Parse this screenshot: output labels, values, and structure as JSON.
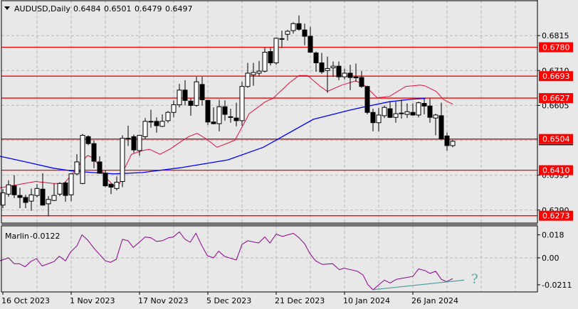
{
  "header": {
    "collapse_icon": "triangle-down-icon",
    "symbol": "AUDUSD,Daily",
    "open": "0.6484",
    "high": "0.6501",
    "low": "0.6479",
    "close": "0.6497"
  },
  "colors": {
    "background": "#e8e8e8",
    "level_line": "#ff0000",
    "ma_fast": "#e0103c",
    "ma_slow": "#0000ff",
    "oscillator": "#8b008b",
    "trendline": "#5aa0a0",
    "candle_up": "#ffffff",
    "candle_down": "#000000"
  },
  "chart_data": [
    {
      "type": "candlestick",
      "title": "AUDUSD,Daily",
      "ylim": [
        0.6251,
        0.692
      ],
      "price_ticks": [
        "0.6815",
        "0.6710",
        "0.6605",
        "0.6395",
        "0.6290"
      ],
      "levels": [
        "0.6780",
        "0.6693",
        "0.6627",
        "0.6504",
        "0.6410",
        "0.6273"
      ],
      "current_price": "0.6504",
      "x_labels": [
        "16 Oct 2023",
        "1 Nov 2023",
        "17 Nov 2023",
        "5 Dec 2023",
        "21 Dec 2023",
        "10 Jan 2024",
        "26 Jan 2024"
      ],
      "x_label_index": [
        0,
        12,
        24,
        36,
        48,
        60,
        72
      ],
      "ohlc": [
        [
          0.6305,
          0.6353,
          0.6296,
          0.6342
        ],
        [
          0.6338,
          0.638,
          0.633,
          0.6366
        ],
        [
          0.6363,
          0.6395,
          0.6326,
          0.6336
        ],
        [
          0.6334,
          0.6357,
          0.6296,
          0.6328
        ],
        [
          0.6328,
          0.6336,
          0.6296,
          0.6313
        ],
        [
          0.6317,
          0.6355,
          0.6288,
          0.6336
        ],
        [
          0.6334,
          0.6368,
          0.6328,
          0.6355
        ],
        [
          0.6353,
          0.6401,
          0.6303,
          0.6305
        ],
        [
          0.6309,
          0.6332,
          0.6271,
          0.6322
        ],
        [
          0.6319,
          0.637,
          0.6317,
          0.6334
        ],
        [
          0.6338,
          0.6374,
          0.6332,
          0.637
        ],
        [
          0.6372,
          0.6376,
          0.6315,
          0.6334
        ],
        [
          0.6336,
          0.6401,
          0.6317,
          0.6399
        ],
        [
          0.6399,
          0.6458,
          0.6395,
          0.6435
        ],
        [
          0.637,
          0.6519,
          0.6368,
          0.6515
        ],
        [
          0.6511,
          0.6515,
          0.6485,
          0.649
        ],
        [
          0.649,
          0.65,
          0.6416,
          0.6437
        ],
        [
          0.6435,
          0.6452,
          0.6399,
          0.6401
        ],
        [
          0.6401,
          0.641,
          0.6359,
          0.6363
        ],
        [
          0.6368,
          0.637,
          0.6338,
          0.6359
        ],
        [
          0.6355,
          0.6391,
          0.6349,
          0.6374
        ],
        [
          0.6376,
          0.6515,
          0.6359,
          0.6506
        ],
        [
          0.6506,
          0.6544,
          0.6483,
          0.6504
        ],
        [
          0.6511,
          0.6517,
          0.6462,
          0.6471
        ],
        [
          0.6469,
          0.6517,
          0.6454,
          0.6515
        ],
        [
          0.6511,
          0.6567,
          0.6504,
          0.6557
        ],
        [
          0.6557,
          0.6592,
          0.6538,
          0.6556
        ],
        [
          0.6557,
          0.6569,
          0.6523,
          0.6544
        ],
        [
          0.6542,
          0.6578,
          0.654,
          0.6557
        ],
        [
          0.6559,
          0.6588,
          0.6553,
          0.6584
        ],
        [
          0.6584,
          0.662,
          0.6569,
          0.6607
        ],
        [
          0.6607,
          0.667,
          0.6599,
          0.6651
        ],
        [
          0.6651,
          0.6681,
          0.6605,
          0.662
        ],
        [
          0.6618,
          0.6626,
          0.6574,
          0.6605
        ],
        [
          0.6605,
          0.6691,
          0.6601,
          0.6676
        ],
        [
          0.6668,
          0.6691,
          0.6605,
          0.6622
        ],
        [
          0.662,
          0.6622,
          0.6546,
          0.6555
        ],
        [
          0.6555,
          0.6599,
          0.6548,
          0.655
        ],
        [
          0.655,
          0.6622,
          0.6527,
          0.6601
        ],
        [
          0.6601,
          0.662,
          0.6559,
          0.6578
        ],
        [
          0.6571,
          0.6595,
          0.6553,
          0.6569
        ],
        [
          0.6567,
          0.6613,
          0.6542,
          0.6559
        ],
        [
          0.6559,
          0.6676,
          0.6544,
          0.6662
        ],
        [
          0.6662,
          0.6733,
          0.6658,
          0.6702
        ],
        [
          0.6697,
          0.6733,
          0.6664,
          0.6704
        ],
        [
          0.6702,
          0.6739,
          0.6693,
          0.6708
        ],
        [
          0.6708,
          0.6779,
          0.6704,
          0.6765
        ],
        [
          0.6767,
          0.6779,
          0.6725,
          0.6733
        ],
        [
          0.6733,
          0.6809,
          0.6727,
          0.6807
        ],
        [
          0.6805,
          0.683,
          0.6777,
          0.6806
        ],
        [
          0.6819,
          0.6832,
          0.68,
          0.6828
        ],
        [
          0.683,
          0.6855,
          0.6821,
          0.6851
        ],
        [
          0.6851,
          0.6876,
          0.683,
          0.6834
        ],
        [
          0.6832,
          0.6851,
          0.6786,
          0.6813
        ],
        [
          0.6813,
          0.6842,
          0.6763,
          0.6765
        ],
        [
          0.6763,
          0.6767,
          0.6706,
          0.6733
        ],
        [
          0.6733,
          0.6763,
          0.67,
          0.6706
        ],
        [
          0.671,
          0.6752,
          0.6643,
          0.6716
        ],
        [
          0.6718,
          0.6737,
          0.6691,
          0.6723
        ],
        [
          0.6723,
          0.6737,
          0.6681,
          0.6691
        ],
        [
          0.6691,
          0.6716,
          0.6683,
          0.6702
        ],
        [
          0.6702,
          0.6727,
          0.6651,
          0.6689
        ],
        [
          0.6689,
          0.6731,
          0.6676,
          0.669
        ],
        [
          0.6689,
          0.6708,
          0.6658,
          0.6662
        ],
        [
          0.6662,
          0.6664,
          0.6578,
          0.6584
        ],
        [
          0.6584,
          0.6595,
          0.6527,
          0.6553
        ],
        [
          0.6553,
          0.6597,
          0.6527,
          0.6576
        ],
        [
          0.6574,
          0.6605,
          0.6567,
          0.6599
        ],
        [
          0.6595,
          0.6616,
          0.6567,
          0.6569
        ],
        [
          0.6569,
          0.6616,
          0.6553,
          0.658
        ],
        [
          0.6582,
          0.6622,
          0.6565,
          0.658
        ],
        [
          0.6578,
          0.6611,
          0.6567,
          0.6586
        ],
        [
          0.6584,
          0.6611,
          0.6574,
          0.6576
        ],
        [
          0.6576,
          0.6616,
          0.6569,
          0.6613
        ],
        [
          0.6611,
          0.6626,
          0.6578,
          0.6603
        ],
        [
          0.6603,
          0.6626,
          0.6553,
          0.6569
        ],
        [
          0.6567,
          0.658,
          0.6515,
          0.6576
        ],
        [
          0.6574,
          0.6613,
          0.6502,
          0.6504
        ],
        [
          0.6513,
          0.6523,
          0.6469,
          0.6484
        ],
        [
          0.6484,
          0.6501,
          0.6479,
          0.6497
        ]
      ],
      "ma_fast": [
        [
          -0.5,
          0.6357
        ],
        [
          5.75,
          0.6376
        ],
        [
          8.9,
          0.637
        ],
        [
          10.75,
          0.637
        ],
        [
          12,
          0.6395
        ],
        [
          13.9,
          0.6437
        ],
        [
          14.9,
          0.6454
        ],
        [
          15.75,
          0.6448
        ],
        [
          17,
          0.6422
        ],
        [
          18.25,
          0.6385
        ],
        [
          19.5,
          0.6363
        ],
        [
          20.5,
          0.637
        ],
        [
          21.4,
          0.6416
        ],
        [
          22.6,
          0.6458
        ],
        [
          24.5,
          0.6469
        ],
        [
          25.75,
          0.6473
        ],
        [
          27.6,
          0.6458
        ],
        [
          29.5,
          0.6475
        ],
        [
          30.75,
          0.649
        ],
        [
          32.6,
          0.6511
        ],
        [
          34.1,
          0.6521
        ],
        [
          35.75,
          0.6504
        ],
        [
          37.6,
          0.6479
        ],
        [
          40.75,
          0.65
        ],
        [
          43.25,
          0.658
        ],
        [
          46.1,
          0.6616
        ],
        [
          47.4,
          0.6626
        ],
        [
          50.4,
          0.6674
        ],
        [
          52,
          0.6695
        ],
        [
          53.5,
          0.6695
        ],
        [
          55.75,
          0.6662
        ],
        [
          57,
          0.6647
        ],
        [
          59.5,
          0.6666
        ],
        [
          62,
          0.6679
        ],
        [
          63.6,
          0.6664
        ],
        [
          65.75,
          0.6628
        ],
        [
          67.9,
          0.6632
        ],
        [
          70.75,
          0.6662
        ],
        [
          73.25,
          0.6666
        ],
        [
          74.1,
          0.6664
        ],
        [
          76.1,
          0.6647
        ],
        [
          77.4,
          0.6622
        ],
        [
          79,
          0.6609
        ]
      ],
      "ma_slow": [
        [
          -0.5,
          0.6452
        ],
        [
          4.5,
          0.6433
        ],
        [
          8.9,
          0.6416
        ],
        [
          12,
          0.6408
        ],
        [
          15.75,
          0.6403
        ],
        [
          19.5,
          0.6399
        ],
        [
          24.5,
          0.6403
        ],
        [
          31.4,
          0.6418
        ],
        [
          39.5,
          0.6441
        ],
        [
          45.75,
          0.6479
        ],
        [
          54.5,
          0.6563
        ],
        [
          60.75,
          0.659
        ],
        [
          63.6,
          0.6601
        ],
        [
          67.9,
          0.6616
        ],
        [
          72,
          0.6624
        ],
        [
          74.25,
          0.6626
        ]
      ]
    },
    {
      "type": "line",
      "title": "Marlin",
      "current_value": "-0.0122",
      "ylim": [
        -0.0267,
        0.025
      ],
      "y_ticks": [
        "0.018",
        "0.00",
        "-0.0211"
      ],
      "series": [
        [
          -0.5,
          -0.0023
        ],
        [
          1,
          0
        ],
        [
          2,
          -0.0046
        ],
        [
          2.9,
          -0.0046
        ],
        [
          3.9,
          -0.007
        ],
        [
          4.9,
          -0.0029
        ],
        [
          5.9,
          -0.0006
        ],
        [
          6.9,
          -0.0064
        ],
        [
          9,
          -0.0029
        ],
        [
          9.9,
          0.0012
        ],
        [
          11,
          -0.0023
        ],
        [
          11.9,
          0.0046
        ],
        [
          13,
          0.0093
        ],
        [
          13.9,
          0.018
        ],
        [
          14.9,
          0.0139
        ],
        [
          16.1,
          0.007
        ],
        [
          18,
          -0.0023
        ],
        [
          18.9,
          -0.0035
        ],
        [
          19.9,
          -0.0012
        ],
        [
          21,
          0.0145
        ],
        [
          22,
          0.0134
        ],
        [
          22.9,
          0.0081
        ],
        [
          25,
          0.0163
        ],
        [
          26,
          0.0157
        ],
        [
          27,
          0.0128
        ],
        [
          28,
          0.0134
        ],
        [
          29.1,
          0.0157
        ],
        [
          29.9,
          0.0163
        ],
        [
          31,
          0.0203
        ],
        [
          32,
          0.0145
        ],
        [
          32.9,
          0.0122
        ],
        [
          33.9,
          0.0192
        ],
        [
          34.9,
          0.0099
        ],
        [
          35.9,
          0.0017
        ],
        [
          37,
          0
        ],
        [
          37.9,
          0.0052
        ],
        [
          38.9,
          0.0012
        ],
        [
          41,
          -0.0017
        ],
        [
          42,
          0.0105
        ],
        [
          43,
          0.0134
        ],
        [
          44.9,
          0.0116
        ],
        [
          46,
          0.0163
        ],
        [
          46.9,
          0.0116
        ],
        [
          48,
          0.0186
        ],
        [
          49.1,
          0.0168
        ],
        [
          51,
          0.0192
        ],
        [
          52,
          0.0157
        ],
        [
          53,
          0.011
        ],
        [
          53.9,
          0.0035
        ],
        [
          54.9,
          -0.0023
        ],
        [
          56.1,
          -0.0052
        ],
        [
          57.9,
          -0.0046
        ],
        [
          59.1,
          -0.0093
        ],
        [
          59.9,
          -0.0081
        ],
        [
          61.1,
          -0.0093
        ],
        [
          62.25,
          -0.0105
        ],
        [
          63.25,
          -0.0134
        ],
        [
          64.1,
          -0.0209
        ],
        [
          65,
          -0.025
        ],
        [
          67,
          -0.0174
        ],
        [
          68,
          -0.0197
        ],
        [
          69.1,
          -0.0168
        ],
        [
          72,
          -0.0145
        ],
        [
          73,
          -0.0087
        ],
        [
          74.1,
          -0.0099
        ],
        [
          75,
          -0.0122
        ],
        [
          76,
          -0.0105
        ],
        [
          77,
          -0.0168
        ],
        [
          77.9,
          -0.0186
        ],
        [
          79,
          -0.0163
        ]
      ],
      "trendline": [
        [
          65,
          -0.025
        ],
        [
          81,
          -0.0174
        ]
      ],
      "annotation": "?"
    }
  ]
}
